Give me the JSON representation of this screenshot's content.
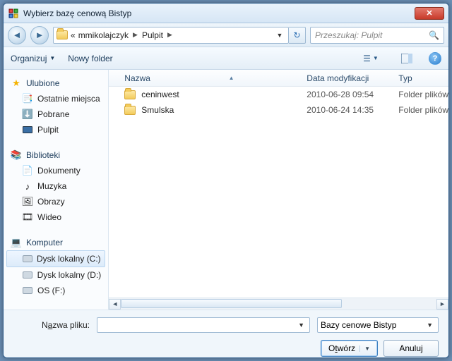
{
  "window": {
    "title": "Wybierz bazę cenową Bistyp"
  },
  "nav": {
    "crumbs": [
      "mmikolajczyk",
      "Pulpit"
    ],
    "search_placeholder": "Przeszukaj: Pulpit"
  },
  "toolbar": {
    "organize": "Organizuj",
    "new_folder": "Nowy folder",
    "help": "?"
  },
  "sidebar": {
    "favorites": {
      "label": "Ulubione",
      "items": [
        "Ostatnie miejsca",
        "Pobrane",
        "Pulpit"
      ]
    },
    "libraries": {
      "label": "Biblioteki",
      "items": [
        "Dokumenty",
        "Muzyka",
        "Obrazy",
        "Wideo"
      ]
    },
    "computer": {
      "label": "Komputer",
      "items": [
        "Dysk lokalny (C:)",
        "Dysk lokalny (D:)",
        "OS (F:)"
      ]
    }
  },
  "columns": {
    "name": "Nazwa",
    "date": "Data modyfikacji",
    "type": "Typ"
  },
  "files": [
    {
      "name": "ceninwest",
      "date": "2010-06-28 09:54",
      "type": "Folder plików"
    },
    {
      "name": "Smulska",
      "date": "2010-06-24 14:35",
      "type": "Folder plików"
    }
  ],
  "bottom": {
    "filename_label_pre": "N",
    "filename_label_u": "a",
    "filename_label_post": "zwa pliku:",
    "filename_value": "",
    "filter": "Bazy cenowe Bistyp",
    "open_pre": "O",
    "open_u": "t",
    "open_post": "wórz",
    "cancel": "Anuluj"
  }
}
